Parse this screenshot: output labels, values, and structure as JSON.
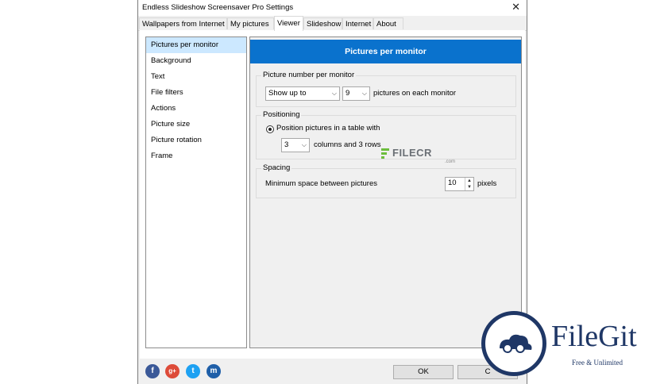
{
  "window": {
    "title": "Endless Slideshow Screensaver Pro Settings",
    "close_glyph": "✕"
  },
  "tabs": [
    {
      "label": "Wallpapers from Internet"
    },
    {
      "label": "My pictures"
    },
    {
      "label": "Viewer"
    },
    {
      "label": "Slideshow"
    },
    {
      "label": "Internet"
    },
    {
      "label": "About"
    }
  ],
  "sidebar": {
    "items": [
      {
        "label": "Pictures per monitor"
      },
      {
        "label": "Background"
      },
      {
        "label": "Text"
      },
      {
        "label": "File filters"
      },
      {
        "label": "Actions"
      },
      {
        "label": "Picture size"
      },
      {
        "label": "Picture rotation"
      },
      {
        "label": "Frame"
      }
    ]
  },
  "panel": {
    "header": "Pictures per monitor"
  },
  "picture_number": {
    "legend": "Picture number per monitor",
    "mode_value": "Show up to",
    "count_value": "9",
    "suffix": "pictures on each monitor"
  },
  "positioning": {
    "legend": "Positioning",
    "radio_label": "Position pictures in a table with",
    "columns_value": "3",
    "suffix": "columns and 3 rows"
  },
  "spacing": {
    "legend": "Spacing",
    "label": "Minimum space between pictures",
    "value": "10",
    "unit": "pixels"
  },
  "footer": {
    "social": [
      {
        "icon": "facebook-icon",
        "glyph": "f",
        "color": "#3b5998"
      },
      {
        "icon": "google-plus-icon",
        "glyph": "g+",
        "color": "#dd4b39"
      },
      {
        "icon": "twitter-icon",
        "glyph": "t",
        "color": "#1da1f2"
      },
      {
        "icon": "myspace-icon",
        "glyph": "m",
        "color": "#1f5fa8"
      }
    ],
    "ok_label": "OK",
    "cancel_label": "C"
  },
  "watermarks": {
    "filecr": {
      "name": "FILECR",
      "domain": ".com"
    },
    "filegit": {
      "name": "FileGit",
      "tagline": "Free & Unlimited"
    }
  },
  "colors": {
    "accent": "#0a72cd",
    "selection": "#cce8ff",
    "filegit_brand": "#1f3766",
    "filecr_green": "#6cbd3c"
  }
}
